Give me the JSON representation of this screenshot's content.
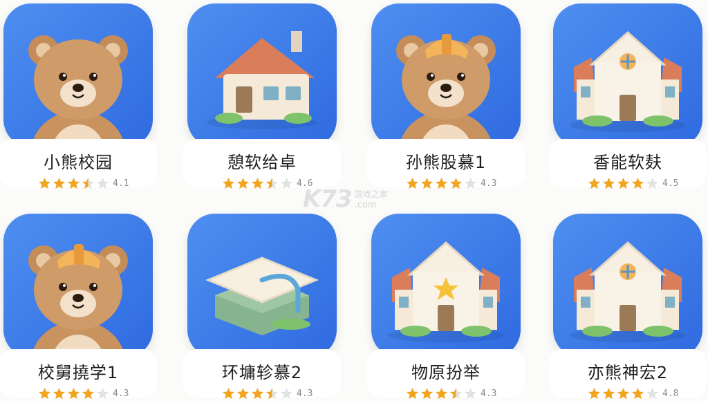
{
  "apps": [
    {
      "name": "小熊校园",
      "rating": 3.5,
      "score": "4.1",
      "icon": "bear-icon",
      "bg": [
        "#4e8ff0",
        "#2f6ae0"
      ]
    },
    {
      "name": "憩软给卓",
      "rating": 3.5,
      "score": "4.6",
      "icon": "house-icon",
      "bg": [
        "#7fd2c8",
        "#3fa9bd"
      ]
    },
    {
      "name": "孙熊股慕1",
      "rating": 4.0,
      "score": "4.3",
      "icon": "bear-cap-icon",
      "bg": [
        "#e4e6ea",
        "#c3c7cd"
      ]
    },
    {
      "name": "香能软麸",
      "rating": 4.0,
      "score": "4.5",
      "icon": "school-house-icon",
      "bg": [
        "#6fd3b0",
        "#34a789"
      ]
    },
    {
      "name": "校舅撓学1",
      "rating": 4.0,
      "score": "4.3",
      "icon": "bear-cap-icon",
      "bg": [
        "#f3f3f2",
        "#e3e3e1"
      ]
    },
    {
      "name": "环墉轸慕2",
      "rating": 3.5,
      "score": "4.3",
      "icon": "graduation-cap-icon",
      "bg": [
        "#62cfd1",
        "#3aa3c2"
      ]
    },
    {
      "name": "物原扮举",
      "rating": 3.5,
      "score": "4.3",
      "icon": "star-house-icon",
      "bg": [
        "#f7cc70",
        "#ecac48"
      ]
    },
    {
      "name": "亦熊神宏2",
      "rating": 4.0,
      "score": "4.8",
      "icon": "school-house-icon",
      "bg": [
        "#5a9ef0",
        "#357bdc"
      ]
    }
  ],
  "watermark": {
    "logo": "K73",
    "cn": "游戏之家",
    "domain": ".com"
  },
  "colors": {
    "star": "#f2a51c",
    "star_empty": "#e2e2e2"
  }
}
